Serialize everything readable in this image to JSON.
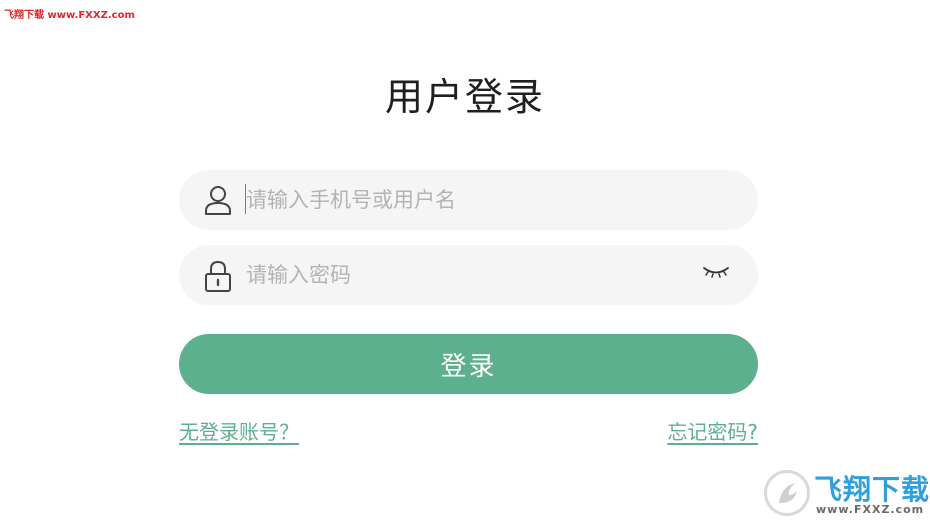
{
  "watermark": {
    "top_text": "飞翔下载 www.FXXZ.com",
    "logo_name": "飞翔下载",
    "logo_url": "www.FXXZ.com"
  },
  "page": {
    "title": "用户登录"
  },
  "form": {
    "username": {
      "placeholder": "请输入手机号或用户名",
      "value": "",
      "icon": "user-icon"
    },
    "password": {
      "placeholder": "请输入密码",
      "value": "",
      "icon": "lock-icon",
      "toggle_icon": "eye-closed-icon"
    },
    "login_label": "登录"
  },
  "links": {
    "register": "无登录账号？",
    "forgot": "忘记密码?"
  },
  "colors": {
    "accent": "#5cb08d",
    "field_bg": "#f5f5f5",
    "placeholder": "#b3b3b3",
    "watermark_red": "#e0262a",
    "watermark_blue": "#2f9fe0"
  }
}
